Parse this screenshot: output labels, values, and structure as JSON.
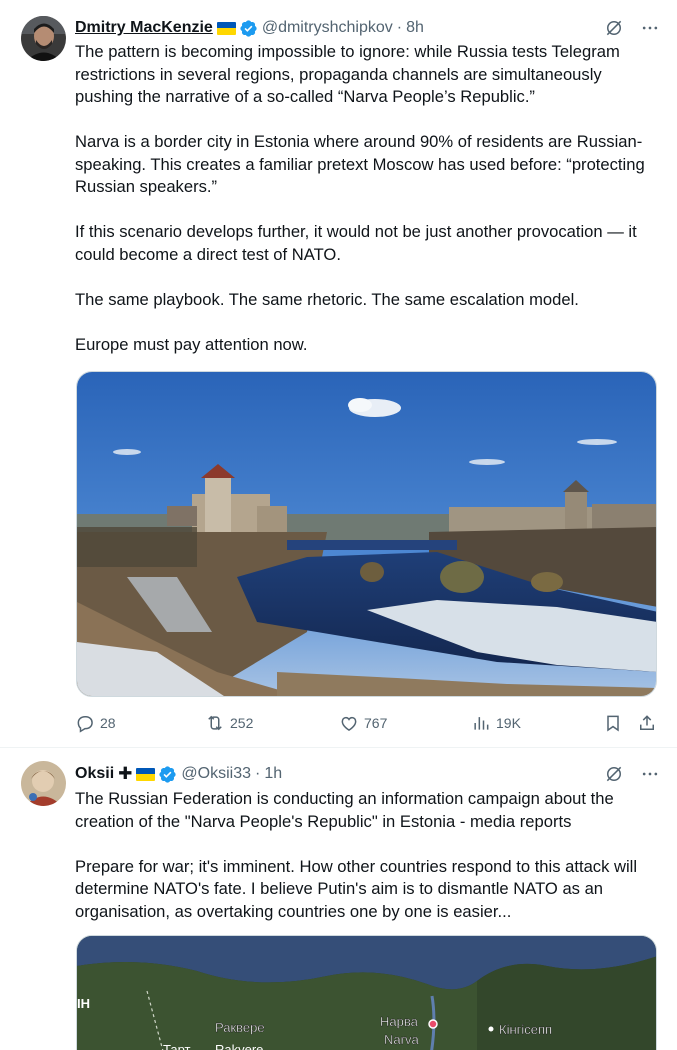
{
  "tweets": [
    {
      "display_name": "Dmitry MacKenzie",
      "handle": "@dmitryshchipkov",
      "separator": "·",
      "time": "8h",
      "paragraphs": [
        "The pattern is becoming impossible to ignore: while Russia tests Telegram restrictions in several regions, propaganda channels are simultaneously pushing the narrative of a so-called “Narva People’s Republic.”",
        "Narva is a border city in Estonia where around 90% of residents are Russian-speaking. This creates a familiar pretext Moscow has used before: “protecting Russian speakers.”",
        "If this scenario develops further, it would not be just another provocation — it could become a direct test of NATO.",
        "The same playbook. The same rhetoric. The same escalation model.",
        "Europe must pay attention now."
      ],
      "stats": {
        "replies": "28",
        "reposts": "252",
        "likes": "767",
        "views": "19K"
      }
    },
    {
      "display_name": "Oksii",
      "handle": "@Oksii33",
      "separator": "·",
      "time": "1h",
      "paragraphs": [
        "The Russian Federation is conducting an information campaign about the creation of the \"Narva People's Republic\" in Estonia - media reports",
        "Prepare for war; it's imminent. How other countries respond to this attack will determine NATO's fate. I believe Putin's aim is to dismantle NATO as an organisation, as overtaking countries one by one is easier..."
      ],
      "map_labels": {
        "rakvere": "Раквере",
        "narva_ru": "Нарва",
        "narva": "Narva",
        "kingisepp": "Кінгісепп",
        "partial_left": "ІН",
        "bottom_partial_1": "Тарт",
        "bottom_partial_2": "Rakvere"
      }
    }
  ],
  "icons": {
    "verified": "verified-badge-icon",
    "grok": "grok-icon",
    "more": "more-icon",
    "reply": "reply-icon",
    "repost": "repost-icon",
    "like": "like-icon",
    "views": "views-icon",
    "bookmark": "bookmark-icon",
    "share": "share-icon"
  },
  "colors": {
    "text": "#0f1419",
    "secondary": "#536471",
    "verified": "#1d9bf0",
    "flag_blue": "#0057b7",
    "flag_yellow": "#ffd700"
  }
}
